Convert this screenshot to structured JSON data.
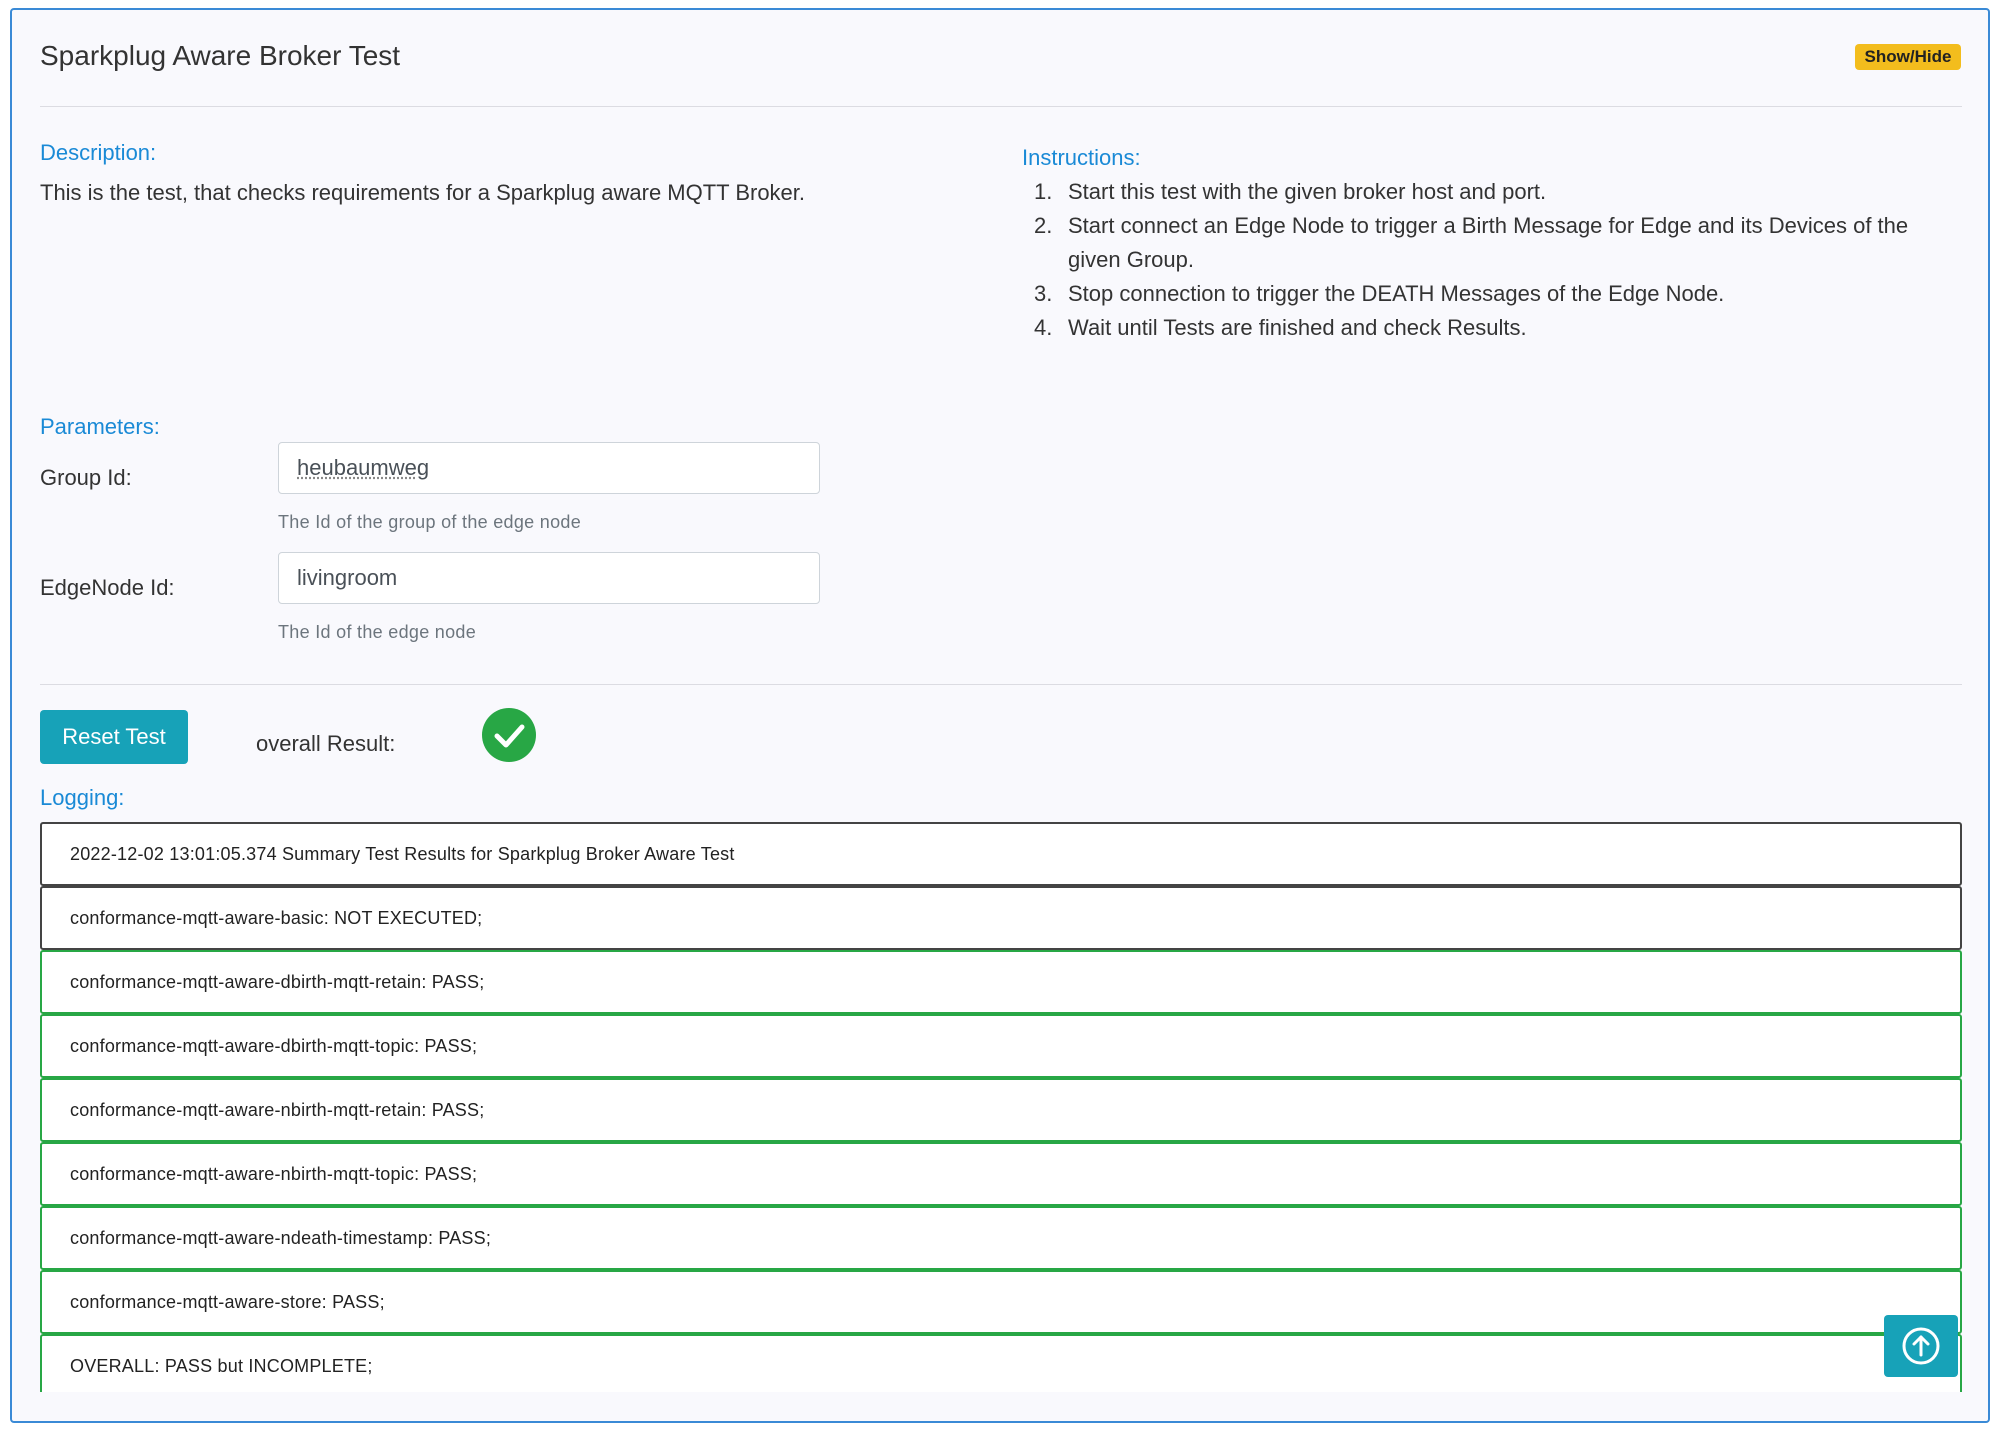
{
  "header": {
    "title": "Sparkplug Aware Broker Test",
    "toggle_label": "Show/Hide"
  },
  "description": {
    "label": "Description:",
    "text": "This is the test, that checks requirements for a Sparkplug aware MQTT Broker."
  },
  "instructions": {
    "label": "Instructions:",
    "items": [
      {
        "num": "1.",
        "text": "Start this test with the given broker host and port."
      },
      {
        "num": "2.",
        "text": "Start connect an Edge Node to trigger a Birth Message for Edge and its Devices of the given Group."
      },
      {
        "num": "3.",
        "text": "Stop connection to trigger the DEATH Messages of the Edge Node."
      },
      {
        "num": "4.",
        "text": "Wait until Tests are finished and check Results."
      }
    ]
  },
  "parameters": {
    "label": "Parameters:",
    "group_id": {
      "label": "Group Id:",
      "value": "heubaumweg",
      "help": "The Id of the group of the edge node"
    },
    "edge_node_id": {
      "label": "EdgeNode Id:",
      "value": "livingroom",
      "help": "The Id of the edge node"
    }
  },
  "actions": {
    "reset_label": "Reset Test",
    "overall_result_label": "overall Result:",
    "overall_result_icon": "check-circle-icon",
    "result_color": "#28a745",
    "accent_color": "#17a2b8"
  },
  "logging": {
    "label": "Logging:",
    "entries": [
      "2022-12-02 13:01:05.374 Summary Test Results for Sparkplug Broker Aware Test",
      "conformance-mqtt-aware-basic: NOT EXECUTED;",
      "conformance-mqtt-aware-dbirth-mqtt-retain: PASS;",
      "conformance-mqtt-aware-dbirth-mqtt-topic: PASS;",
      "conformance-mqtt-aware-nbirth-mqtt-retain: PASS;",
      "conformance-mqtt-aware-nbirth-mqtt-topic: PASS;",
      "conformance-mqtt-aware-ndeath-timestamp: PASS;",
      "conformance-mqtt-aware-store: PASS;",
      "OVERALL: PASS but INCOMPLETE;"
    ]
  },
  "scroll_top_icon": "arrow-up-icon"
}
